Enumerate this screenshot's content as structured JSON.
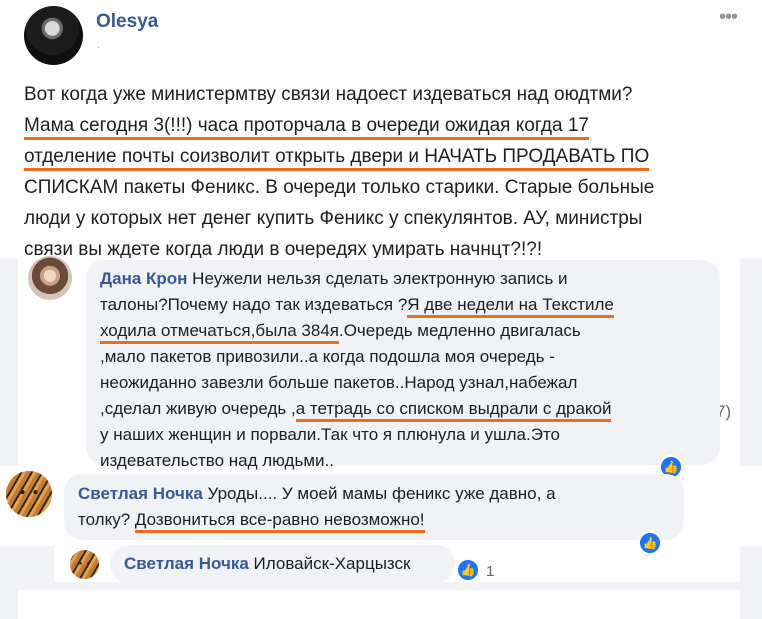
{
  "post": {
    "author": "Olesya",
    "meta_dot": ".",
    "text_lines": [
      "Вот когда уже министермтву связи надоест издеваться над оюдтми?",
      "Мама сегодня 3(!!!) часа проторчала в очереди ожидая когда 17",
      "отделение почты соизволит открыть двери и НАЧАТЬ ПРОДАВАТЬ ПО",
      "СПИСКАМ пакеты Феникс. В очереди только старики. Старые больные",
      "люди у которых нет денег купить Феникс у спекулянтов. АУ, министры",
      "связи вы ждете когда люди в очередях умирать начнцт?!?!"
    ]
  },
  "comments": [
    {
      "author": "Дана Крон",
      "line1": " Неужели нельзя сделать электронную запись и",
      "line2_plain": "талоны?Почему надо так издеваться ?",
      "line2_hl": "Я две недели на Текстиле",
      "line3_hl": "ходила отмечаться,была 384я",
      "line3_plain": ".Очередь медленно двигалась",
      "line4": ",мало пакетов привозили..а когда подошла моя очередь -",
      "line5": "неожиданно завезли больше пакетов..Народ узнал,набежал",
      "line6_plain": ",сделал живую очередь ,",
      "line6_hl": "а тетрадь со списком выдрали с дракой",
      "line7": "у наших женщин и порвали.Так что я плюнула и ушла.Это",
      "line8": "издевательство над людьми.."
    },
    {
      "author": "Светлая Ночка",
      "line1": " Уроды.... У моей мамы феникс уже давно, а",
      "line2_plain": "толку? ",
      "line2_hl": "Дозвониться все-равно невозможно!"
    },
    {
      "author": "Светлая Ночка",
      "text": " Иловайск-Харцызск",
      "likes": "1"
    }
  ],
  "reply_count_fragment": "7)",
  "like_icon": "thumbs-up-icon"
}
